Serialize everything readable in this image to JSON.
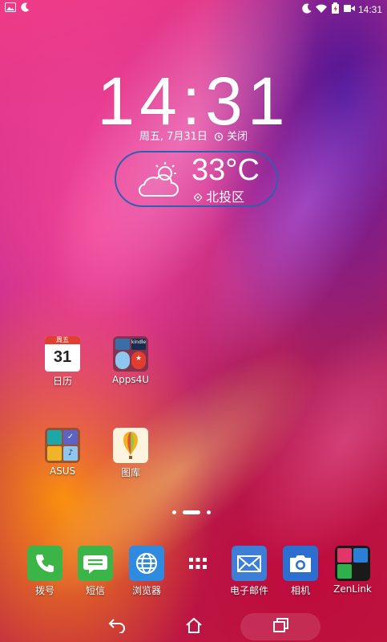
{
  "status_bar": {
    "time": "14:31",
    "left_icons": [
      "image-notification-icon",
      "moon-icon"
    ],
    "right_icons": [
      "moon-icon",
      "wifi-icon",
      "battery-charging-icon",
      "video-icon"
    ]
  },
  "clock": {
    "time": "14:31",
    "date_text": "周五, 7月31日",
    "alarm_text": "关闭"
  },
  "weather": {
    "temperature": "33°C",
    "location": "北投区",
    "icon": "partly-cloudy-icon",
    "border_color": "#2f5fb0"
  },
  "home_apps": [
    {
      "label": "日历",
      "icon": "calendar-icon",
      "calendar_header": "周五",
      "calendar_day": "31"
    },
    {
      "label": "Apps4U",
      "icon": "folder-icon",
      "folder_mini_text": "kindle"
    },
    {
      "label": "ASUS",
      "icon": "folder-icon"
    },
    {
      "label": "图库",
      "icon": "gallery-balloon-icon"
    }
  ],
  "page_indicator": {
    "pages": 3,
    "current": 2
  },
  "dock": [
    {
      "label": "拨号",
      "icon": "phone-icon",
      "color": "#3bb548"
    },
    {
      "label": "短信",
      "icon": "message-icon",
      "color": "#3bb548"
    },
    {
      "label": "浏览器",
      "icon": "globe-icon",
      "color": "#2f8be0"
    },
    {
      "label": "",
      "icon": "apps-grid-icon",
      "color": "#ffffff"
    },
    {
      "label": "电子邮件",
      "icon": "mail-icon",
      "color": "#3d7ed6"
    },
    {
      "label": "相机",
      "icon": "camera-icon",
      "color": "#2c6fd0"
    },
    {
      "label": "ZenLink",
      "icon": "folder-icon",
      "color": "#1a1a1a"
    }
  ],
  "navigation": [
    "back-icon",
    "home-icon",
    "recents-icon"
  ]
}
